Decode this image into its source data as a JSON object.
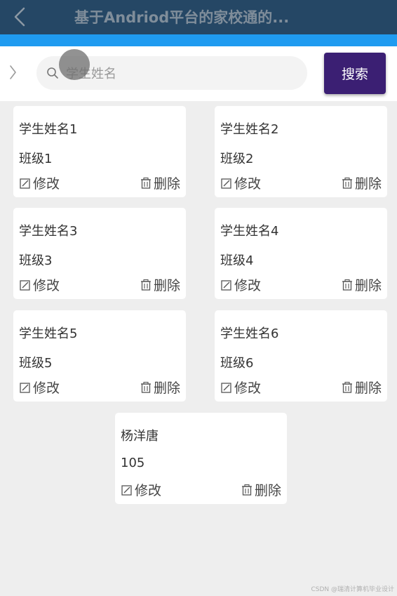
{
  "app_bar": {
    "title": "基于Andriod平台的家校通的..."
  },
  "search": {
    "placeholder": "学生姓名",
    "value": "",
    "button_label": "搜索"
  },
  "cards": [
    {
      "name": "学生姓名1",
      "class": "班级1",
      "edit_label": "修改",
      "delete_label": "删除"
    },
    {
      "name": "学生姓名2",
      "class": "班级2",
      "edit_label": "修改",
      "delete_label": "删除"
    },
    {
      "name": "学生姓名3",
      "class": "班级3",
      "edit_label": "修改",
      "delete_label": "删除"
    },
    {
      "name": "学生姓名4",
      "class": "班级4",
      "edit_label": "修改",
      "delete_label": "删除"
    },
    {
      "name": "学生姓名5",
      "class": "班级5",
      "edit_label": "修改",
      "delete_label": "删除"
    },
    {
      "name": "学生姓名6",
      "class": "班级6",
      "edit_label": "修改",
      "delete_label": "删除"
    },
    {
      "name": "杨洋唐",
      "class": "105",
      "edit_label": "修改",
      "delete_label": "删除"
    }
  ],
  "watermark": "CSDN @瑞清计算机毕业设计",
  "colors": {
    "app_bar": "#254765",
    "accent_strip": "#1f9bf0",
    "search_button": "#3b1f73",
    "page_background": "#eeeeee",
    "card_background": "#ffffff"
  },
  "icons": {
    "back": "chevron-left-icon",
    "expand": "chevron-right-icon",
    "search": "search-icon",
    "edit": "edit-icon",
    "delete": "trash-icon"
  }
}
